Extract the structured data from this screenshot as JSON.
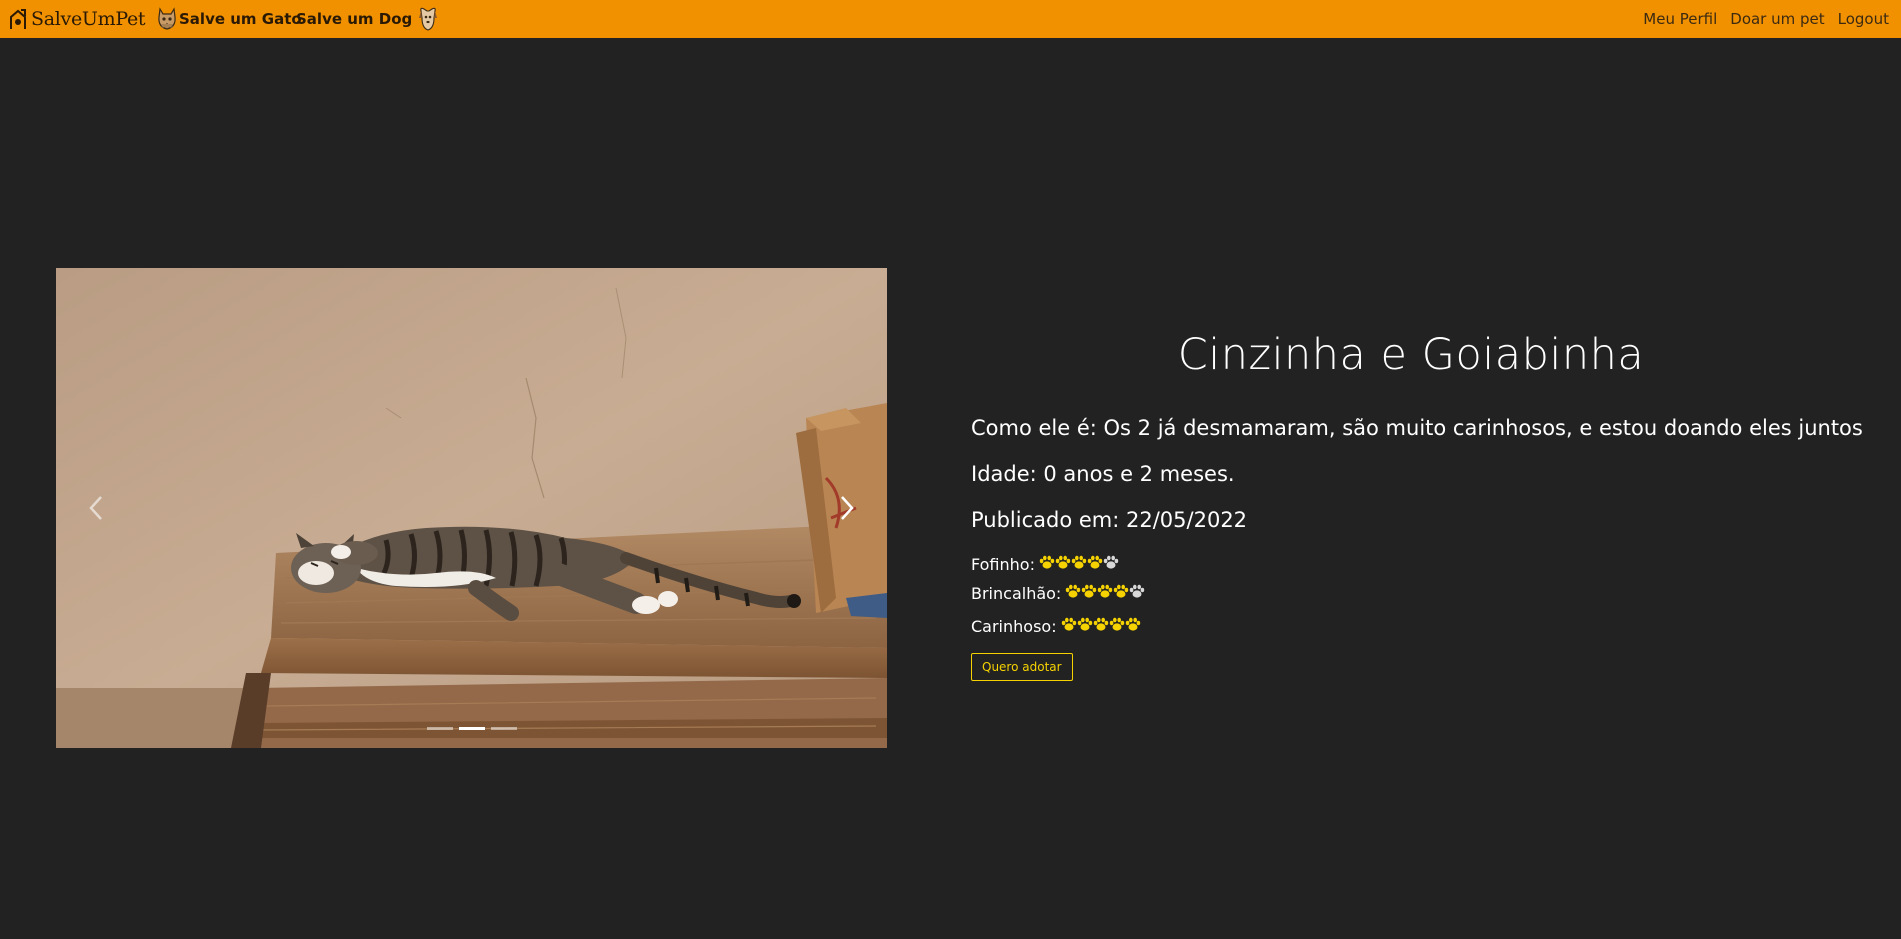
{
  "navbar": {
    "brand": "SalveUmPet",
    "left_links": [
      "Salve um Gato",
      "Salve um Dog"
    ],
    "right_links": [
      "Meu Perfil",
      "Doar um pet",
      "Logout"
    ],
    "background": "#f29100"
  },
  "carousel": {
    "slides": 3,
    "active_slide": 2
  },
  "pet": {
    "name": "Cinzinha e Goiabinha",
    "description": "Como ele é: Os 2 já desmamaram, são muito carinhosos, e estou doando eles juntos",
    "age": "Idade: 0 anos e 2 meses.",
    "published": "Publicado em: 22/05/2022",
    "ratings": [
      {
        "label": "Fofinho:",
        "value": 4,
        "max": 5
      },
      {
        "label": "Brincalhão:",
        "value": 4,
        "max": 5
      },
      {
        "label": "Carinhoso:",
        "value": 5,
        "max": 5
      }
    ],
    "adopt_button": "Quero adotar"
  },
  "colors": {
    "paw_filled": "#f5d200",
    "paw_empty": "#d8d8d8",
    "accent": "#f5d200"
  }
}
